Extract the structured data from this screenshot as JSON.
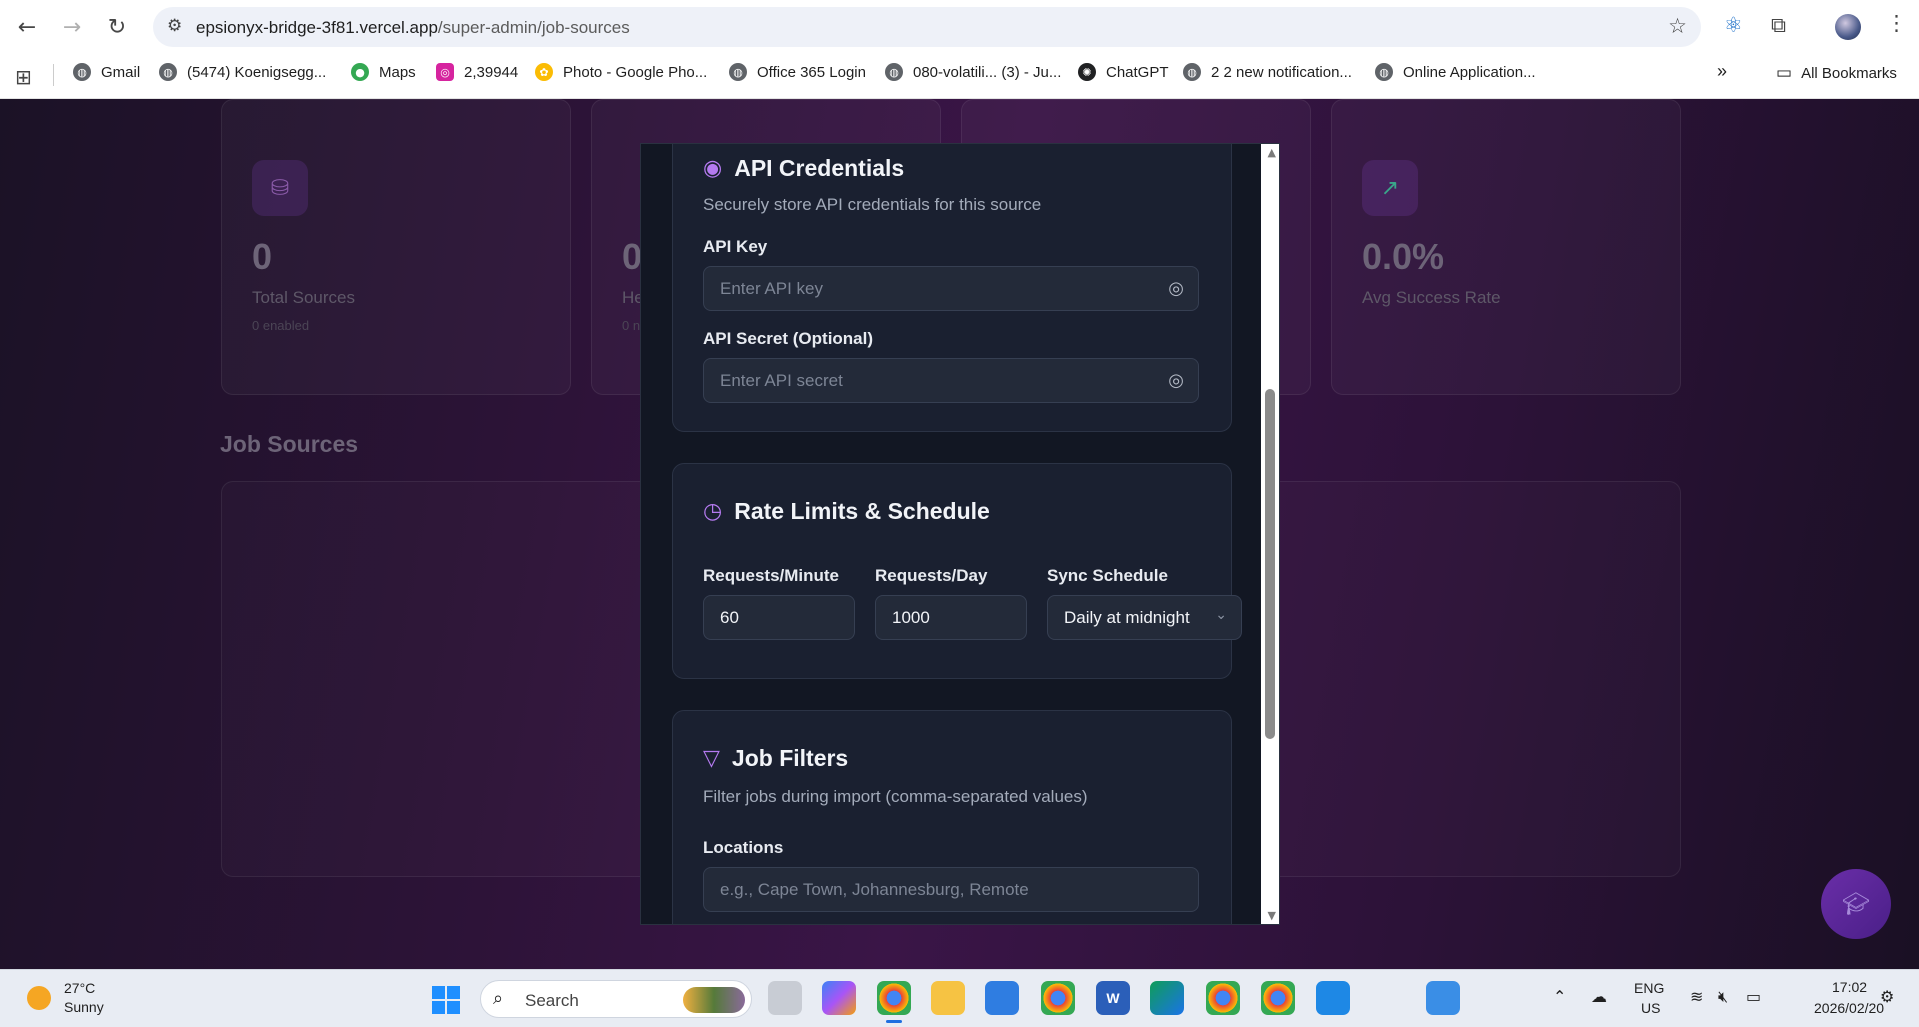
{
  "browser": {
    "url_main": "epsionyx-bridge-3f81.vercel.app",
    "url_path": "/super-admin/job-sources",
    "icons": {
      "back": "arrow-left-icon",
      "forward": "arrow-right-icon",
      "reload": "reload-icon",
      "star": "star-icon",
      "extensions": "puzzle-icon"
    }
  },
  "bookmarks": [
    {
      "label": "Gmail",
      "icon": "globe-icon"
    },
    {
      "label": "(5474) Koenigsegg...",
      "icon": "globe-icon"
    },
    {
      "label": "Maps",
      "icon": "maps-pin-icon"
    },
    {
      "label": "2,39944",
      "icon": "instagram-icon"
    },
    {
      "label": "Photo - Google Pho...",
      "icon": "photos-icon"
    },
    {
      "label": "Office 365 Login",
      "icon": "globe-icon"
    },
    {
      "label": "080-volatili... (3) - Ju...",
      "icon": "globe-icon"
    },
    {
      "label": "ChatGPT",
      "icon": "openai-icon"
    },
    {
      "label": "2 2 new notification...",
      "icon": "globe-icon"
    },
    {
      "label": "Online Application...",
      "icon": "globe-icon"
    }
  ],
  "bookmarks_more": "»",
  "all_bookmarks": "All Bookmarks",
  "stats": [
    {
      "value": "0",
      "label": "Total Sources",
      "sub": "0 enabled",
      "icon": "database-icon"
    },
    {
      "value": "0",
      "label": "He",
      "sub": "0 n",
      "icon": ""
    },
    {
      "value": "",
      "label": "",
      "sub": "",
      "icon": ""
    },
    {
      "value": "0.0%",
      "label": "Avg Success Rate",
      "sub": "",
      "icon": "trending-up-icon"
    }
  ],
  "section_title": "Job Sources",
  "modal": {
    "api": {
      "title": "API Credentials",
      "icon": "eye-icon",
      "desc": "Securely store API credentials for this source",
      "key_label": "API Key",
      "key_placeholder": "Enter API key",
      "secret_label": "API Secret (Optional)",
      "secret_placeholder": "Enter API secret"
    },
    "rate": {
      "title": "Rate Limits & Schedule",
      "icon": "clock-icon",
      "rpm_label": "Requests/Minute",
      "rpm_value": "60",
      "rpd_label": "Requests/Day",
      "rpd_value": "1000",
      "sync_label": "Sync Schedule",
      "sync_value": "Daily at midnight"
    },
    "filters": {
      "title": "Job Filters",
      "icon": "filter-icon",
      "desc": "Filter jobs during import (comma-separated values)",
      "loc_label": "Locations",
      "loc_placeholder": "e.g., Cape Town, Johannesburg, Remote"
    }
  },
  "taskbar": {
    "temp": "27°C",
    "weather": "Sunny",
    "search": "Search",
    "lang_top": "ENG",
    "lang_bottom": "US",
    "time": "17:02",
    "date": "2026/02/20"
  }
}
